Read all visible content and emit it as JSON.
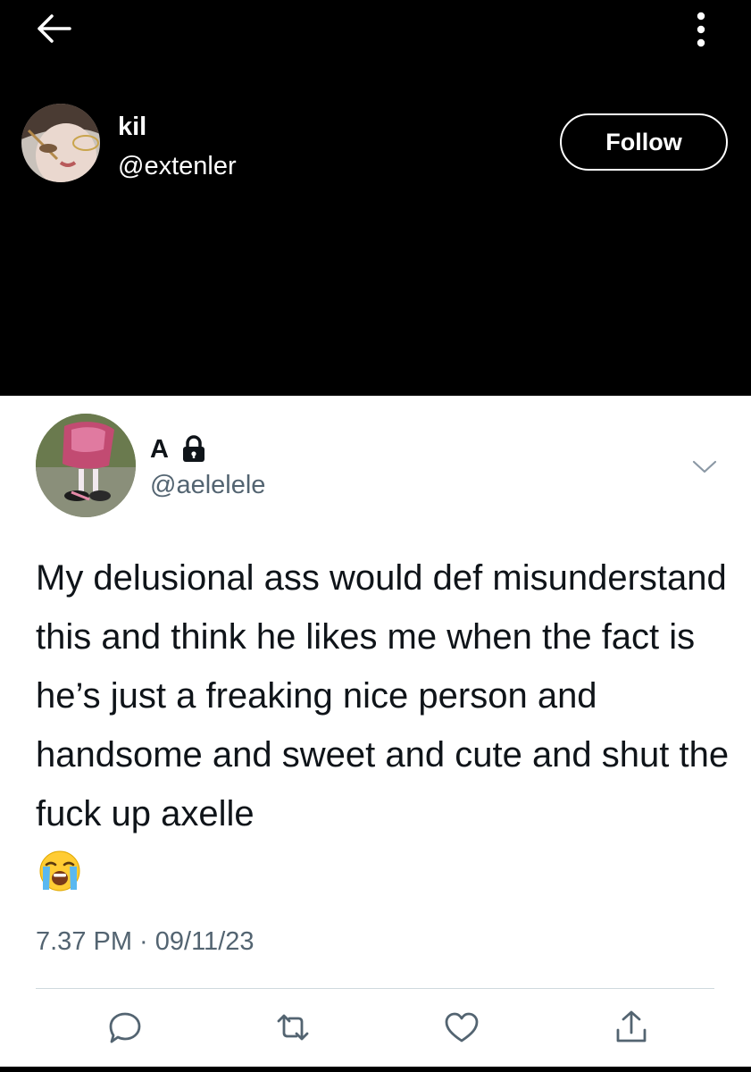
{
  "header": {
    "back_icon": "arrow-left-icon",
    "more_icon": "more-vertical-icon"
  },
  "profile": {
    "name": "kil",
    "handle": "@extenler",
    "follow_label": "Follow"
  },
  "tweet": {
    "author_name": "A",
    "protected_icon": "lock-icon",
    "author_handle": "@aelelele",
    "text": "My delusional ass would def misunderstand this and think he likes me when the fact is he’s just a freaking nice person and handsome and sweet and cute and shut the fuck up axelle",
    "emoji": "loudly-crying-face",
    "timestamp": "7.37 PM · 09/11/23",
    "actions": [
      "reply-icon",
      "retweet-icon",
      "like-icon",
      "share-icon"
    ]
  },
  "colors": {
    "top_background": "#000000",
    "tweet_background": "#ffffff",
    "text_primary": "#0f1419",
    "text_secondary": "#536471",
    "divider": "#cfd9de"
  }
}
